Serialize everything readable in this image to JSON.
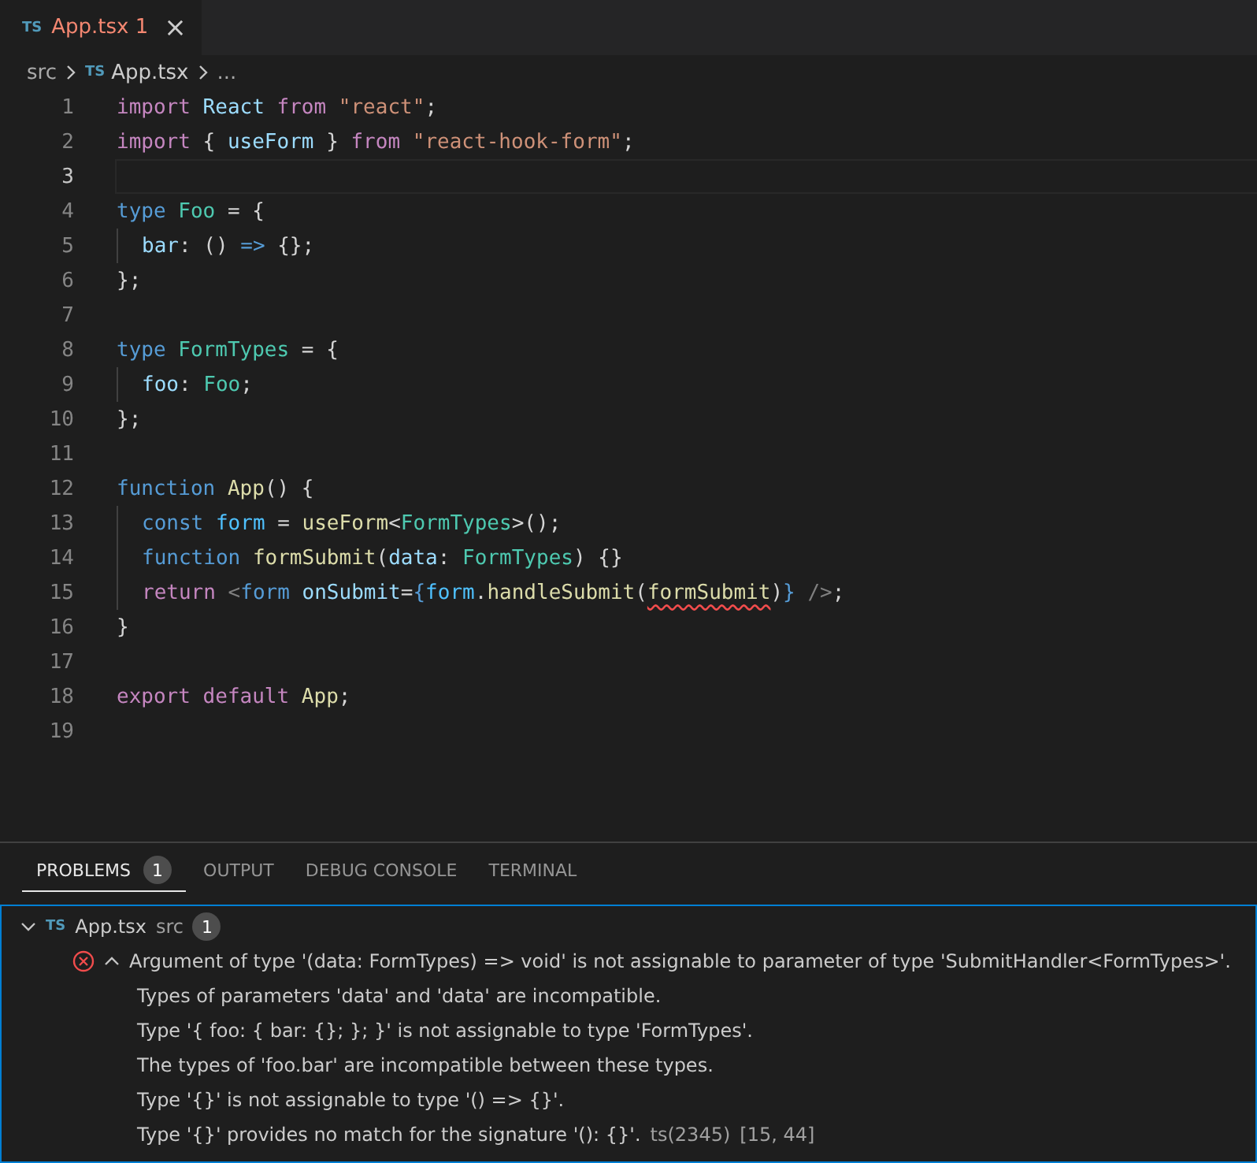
{
  "editor_tabs": [
    {
      "icon_text": "TS",
      "label": "App.tsx",
      "badge": "1",
      "selected": true,
      "has_error": true,
      "close": "×"
    }
  ],
  "breadcrumbs": [
    {
      "text": "src",
      "kind": "folder"
    },
    {
      "text": "App.tsx",
      "kind": "file",
      "icon_text": "TS"
    },
    {
      "text": "...",
      "kind": "symbol"
    }
  ],
  "code_lines": [
    {
      "number": "1",
      "current": false,
      "indented": false,
      "tokens": [
        {
          "text": "import ",
          "kind": "control"
        },
        {
          "text": "React ",
          "kind": "variable"
        },
        {
          "text": "from ",
          "kind": "control"
        },
        {
          "text": "\"react\"",
          "kind": "string"
        },
        {
          "text": ";",
          "kind": "punct"
        }
      ]
    },
    {
      "number": "2",
      "current": false,
      "indented": false,
      "tokens": [
        {
          "text": "import ",
          "kind": "control"
        },
        {
          "text": "{ ",
          "kind": "punct"
        },
        {
          "text": "useForm ",
          "kind": "variable"
        },
        {
          "text": "} ",
          "kind": "punct"
        },
        {
          "text": "from ",
          "kind": "control"
        },
        {
          "text": "\"react-hook-form\"",
          "kind": "string"
        },
        {
          "text": ";",
          "kind": "punct"
        }
      ]
    },
    {
      "number": "3",
      "current": true,
      "indented": false
    },
    {
      "number": "4",
      "current": false,
      "indented": false,
      "tokens": [
        {
          "text": "type ",
          "kind": "storage"
        },
        {
          "text": "Foo ",
          "kind": "type"
        },
        {
          "text": "= {",
          "kind": "punct"
        }
      ]
    },
    {
      "number": "5",
      "current": false,
      "indented": true,
      "tokens": [
        {
          "text": "bar",
          "kind": "variable"
        },
        {
          "text": ": () ",
          "kind": "punct"
        },
        {
          "text": "=> ",
          "kind": "storage"
        },
        {
          "text": "{};",
          "kind": "punct"
        }
      ]
    },
    {
      "number": "6",
      "current": false,
      "indented": false,
      "tokens": [
        {
          "text": "};",
          "kind": "punct"
        }
      ]
    },
    {
      "number": "7",
      "current": false,
      "indented": false
    },
    {
      "number": "8",
      "current": false,
      "indented": false,
      "tokens": [
        {
          "text": "type ",
          "kind": "storage"
        },
        {
          "text": "FormTypes ",
          "kind": "type"
        },
        {
          "text": "= {",
          "kind": "punct"
        }
      ]
    },
    {
      "number": "9",
      "current": false,
      "indented": true,
      "tokens": [
        {
          "text": "foo",
          "kind": "variable"
        },
        {
          "text": ": ",
          "kind": "punct"
        },
        {
          "text": "Foo",
          "kind": "type"
        },
        {
          "text": ";",
          "kind": "punct"
        }
      ]
    },
    {
      "number": "10",
      "current": false,
      "indented": false,
      "tokens": [
        {
          "text": "};",
          "kind": "punct"
        }
      ]
    },
    {
      "number": "11",
      "current": false,
      "indented": false
    },
    {
      "number": "12",
      "current": false,
      "indented": false,
      "tokens": [
        {
          "text": "function ",
          "kind": "storage"
        },
        {
          "text": "App",
          "kind": "function"
        },
        {
          "text": "() {",
          "kind": "punct"
        }
      ]
    },
    {
      "number": "13",
      "current": false,
      "indented": true,
      "tokens": [
        {
          "text": "const ",
          "kind": "storage"
        },
        {
          "text": "form ",
          "kind": "constant"
        },
        {
          "text": "= ",
          "kind": "punct"
        },
        {
          "text": "useForm",
          "kind": "function"
        },
        {
          "text": "<",
          "kind": "punct"
        },
        {
          "text": "FormTypes",
          "kind": "type"
        },
        {
          "text": ">();",
          "kind": "punct"
        }
      ]
    },
    {
      "number": "14",
      "current": false,
      "indented": true,
      "tokens": [
        {
          "text": "function ",
          "kind": "storage"
        },
        {
          "text": "formSubmit",
          "kind": "function"
        },
        {
          "text": "(",
          "kind": "punct"
        },
        {
          "text": "data",
          "kind": "variable"
        },
        {
          "text": ": ",
          "kind": "punct"
        },
        {
          "text": "FormTypes",
          "kind": "type"
        },
        {
          "text": ") {}",
          "kind": "punct"
        }
      ]
    },
    {
      "number": "15",
      "current": false,
      "indented": true,
      "tokens": [
        {
          "text": "return ",
          "kind": "control"
        },
        {
          "text": "<",
          "kind": "tag"
        },
        {
          "text": "form ",
          "kind": "storage"
        },
        {
          "text": "onSubmit",
          "kind": "variable"
        },
        {
          "text": "=",
          "kind": "punct"
        },
        {
          "text": "{",
          "kind": "storage"
        },
        {
          "text": "form",
          "kind": "constant"
        },
        {
          "text": ".",
          "kind": "punct"
        },
        {
          "text": "handleSubmit",
          "kind": "function"
        },
        {
          "text": "(",
          "kind": "punct"
        },
        {
          "text": "formSubmit",
          "kind": "function",
          "error": true
        },
        {
          "text": ")",
          "kind": "punct"
        },
        {
          "text": "} ",
          "kind": "storage"
        },
        {
          "text": "/>",
          "kind": "tag"
        },
        {
          "text": ";",
          "kind": "punct"
        }
      ]
    },
    {
      "number": "16",
      "current": false,
      "indented": false,
      "tokens": [
        {
          "text": "}",
          "kind": "punct"
        }
      ]
    },
    {
      "number": "17",
      "current": false,
      "indented": false
    },
    {
      "number": "18",
      "current": false,
      "indented": false,
      "tokens": [
        {
          "text": "export ",
          "kind": "control"
        },
        {
          "text": "default ",
          "kind": "control"
        },
        {
          "text": "App",
          "kind": "function"
        },
        {
          "text": ";",
          "kind": "punct"
        }
      ]
    },
    {
      "number": "19",
      "current": false,
      "indented": false
    }
  ],
  "panel_tabs": [
    {
      "label": "PROBLEMS",
      "badge": "1",
      "selected": true
    },
    {
      "label": "OUTPUT",
      "selected": false
    },
    {
      "label": "DEBUG CONSOLE",
      "selected": false
    },
    {
      "label": "TERMINAL",
      "selected": false
    }
  ],
  "problems": {
    "file": {
      "icon_text": "TS",
      "name": "App.tsx",
      "folder": "src",
      "count": "1",
      "expanded": true
    },
    "message": {
      "kind": "error",
      "expanded": true,
      "lines": [
        "Argument of type '(data: FormTypes) => void' is not assignable to parameter of type 'SubmitHandler<FormTypes>'.",
        "Types of parameters 'data' and 'data' are incompatible.",
        "Type '{ foo: { bar: {}; }; }' is not assignable to type 'FormTypes'.",
        "The types of 'foo.bar' are incompatible between these types.",
        "Type '{}' is not assignable to type '() => {}'.",
        "Type '{}' provides no match for the signature '(): {}'."
      ],
      "code": "ts(2345)",
      "position": "[15, 44]"
    }
  }
}
